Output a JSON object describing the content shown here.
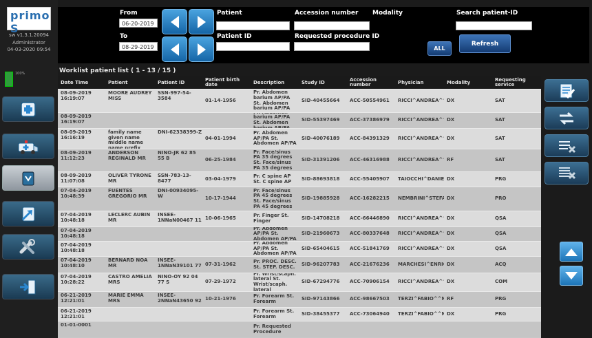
{
  "app": {
    "logo_text": "primo S",
    "version": "sw v1.3.1.20094",
    "user": "Administrator",
    "datetime": "04-03-2020 09:54",
    "battery": "100%"
  },
  "filters": {
    "from_label": "From",
    "from_value": "06-20-2019",
    "to_label": "To",
    "to_value": "08-29-2019",
    "patient_label": "Patient",
    "patient_value": "",
    "patient_id_label": "Patient ID",
    "patient_id_value": "",
    "accession_label": "Accession number",
    "accession_value": "",
    "requested_proc_label": "Requested procedure ID",
    "requested_proc_value": "",
    "modality_label": "Modality",
    "modality_button": "ALL",
    "search_patient_id_label": "Search patient-ID",
    "search_patient_id_value": "",
    "refresh_label": "Refresh"
  },
  "worklist": {
    "title": "Worklist patient list ( 1 - 13 / 15 )",
    "columns": [
      "Date Time",
      "Patient",
      "Patient ID",
      "Patient birth date",
      "Description",
      "Study ID",
      "Accession number",
      "Physician",
      "Modality",
      "Requesting service"
    ],
    "rows": [
      {
        "datetime": "08-09-2019 16:19:07",
        "patient": "MOORE AUDREY MISS",
        "patient_id": "SSN-997-54-3584",
        "birth": "01-14-1956",
        "description": "Pr. Abdomen barium AP/PA St. Abdomen barium AP/PA",
        "study_id": "SID-40455664",
        "accession": "ACC-50554961",
        "physician": "RICCI^ANDREA^^",
        "modality": "DX",
        "service": "SAT"
      },
      {
        "datetime": "08-09-2019 16:19:07",
        "patient": "",
        "patient_id": "",
        "birth": "",
        "description": "Pr. Abdomen barium AP/PA St. Abdomen barium AP/PA",
        "study_id": "SID-55397469",
        "accession": "ACC-37386979",
        "physician": "RICCI^ANDREA^^",
        "modality": "DX",
        "service": "SAT"
      },
      {
        "datetime": "08-09-2019 16:16:19",
        "patient": "family name given name middle name name prefix name suffix",
        "patient_id": "DNI-62338399-Z",
        "birth": "04-01-1994",
        "description": "Pr. Abdomen AP/PA St. Abdomen AP/PA",
        "study_id": "SID-40076189",
        "accession": "ACC-84391329",
        "physician": "RICCI^ANDREA^^",
        "modality": "DX",
        "service": "SAT"
      },
      {
        "datetime": "08-09-2019 11:12:23",
        "patient": "ANDERSON REGINALD MR",
        "patient_id": "NINO-JR 62 85 55 B",
        "birth": "06-25-1984",
        "description": "Pr. Face/sinus PA 35 degrees St. Face/sinus PA 35 degrees",
        "study_id": "SID-31391206",
        "accession": "ACC-46316988",
        "physician": "RICCI^ANDREA^^",
        "modality": "RF",
        "service": "SAT"
      },
      {
        "datetime": "08-09-2019 11:07:08",
        "patient": "OLIVER TYRONE MR",
        "patient_id": "SSN-783-13-8477",
        "birth": "03-04-1979",
        "description": "Pr. C spine AP St. C spine AP",
        "study_id": "SID-88693818",
        "accession": "ACC-55405907",
        "physician": "TAIOCCHI^DANIELE",
        "modality": "DX",
        "service": "PRG"
      },
      {
        "datetime": "07-04-2019 10:48:39",
        "patient": "FUENTES GREGORIO MR",
        "patient_id": "DNI-00934095-W",
        "birth": "10-17-1944",
        "description": "Pr. Face/sinus PA 45 degrees St. Face/sinus PA 45 degrees",
        "study_id": "SID-19885928",
        "accession": "ACC-16282215",
        "physician": "NEMBRINI^STEFANO",
        "modality": "DX",
        "service": "PRO"
      },
      {
        "datetime": "07-04-2019 10:48:18",
        "patient": "LECLERC AUBIN MR",
        "patient_id": "INSEE-1NNaN00467 11",
        "birth": "10-06-1965",
        "description": "Pr. Finger St. Finger",
        "study_id": "SID-14708218",
        "accession": "ACC-66446890",
        "physician": "RICCI^ANDREA^^",
        "modality": "DX",
        "service": "QSA"
      },
      {
        "datetime": "07-04-2019 10:48:18",
        "patient": "",
        "patient_id": "",
        "birth": "",
        "description": "Pr. Abdomen AP/PA St. Abdomen AP/PA",
        "study_id": "SID-21960673",
        "accession": "ACC-80337648",
        "physician": "RICCI^ANDREA^^",
        "modality": "DX",
        "service": "QSA"
      },
      {
        "datetime": "07-04-2019 10:48:18",
        "patient": "",
        "patient_id": "",
        "birth": "",
        "description": "Pr. Abdomen AP/PA St. Abdomen AP/PA",
        "study_id": "SID-65404615",
        "accession": "ACC-51841769",
        "physician": "RICCI^ANDREA^^",
        "modality": "DX",
        "service": "QSA"
      },
      {
        "datetime": "07-04-2019 10:48:10",
        "patient": "BERNARD NOA MR",
        "patient_id": "INSEE-1NNaN39101 77",
        "birth": "07-31-1962",
        "description": "Pr. PROC. DESC. St. STEP. DESC.",
        "study_id": "SID-96207783",
        "accession": "ACC-21676236",
        "physician": "MARCHESI^ENRICO",
        "modality": "DX",
        "service": "ACQ"
      },
      {
        "datetime": "07-04-2019 10:28:22",
        "patient": "CASTRO AMELIA MRS",
        "patient_id": "NINO-OY 92 04 77 S",
        "birth": "07-29-1972",
        "description": "Pr. Wrist/scaph. lateral St. Wrist/scaph. lateral",
        "study_id": "SID-67294776",
        "accession": "ACC-70906154",
        "physician": "RICCI^ANDREA^^",
        "modality": "DX",
        "service": "COM"
      },
      {
        "datetime": "06-21-2019 12:21:01",
        "patient": "MARIE EMMA MRS",
        "patient_id": "INSEE-2NNaN43650 92",
        "birth": "10-21-1976",
        "description": "Pr. Forearm St. Forearm",
        "study_id": "SID-97143866",
        "accession": "ACC-98667503",
        "physician": "TERZI^FABIO^^MD",
        "modality": "RF",
        "service": "PRG"
      },
      {
        "datetime": "06-21-2019 12:21:01",
        "patient": "",
        "patient_id": "",
        "birth": "",
        "description": "Pr. Forearm St. Forearm",
        "study_id": "SID-38455377",
        "accession": "ACC-73064940",
        "physician": "TERZI^FABIO^^MD",
        "modality": "DX",
        "service": "PRG"
      },
      {
        "datetime": "01-01-0001",
        "patient": "",
        "patient_id": "",
        "birth": "",
        "description": "Pr. Requested Procedure",
        "study_id": "",
        "accession": "",
        "physician": "",
        "modality": "",
        "service": ""
      }
    ]
  },
  "icons": {
    "sidebar": [
      "new-patient-icon",
      "ambulance-icon",
      "edit-icon",
      "export-icon",
      "tools-icon",
      "exit-icon"
    ],
    "right": [
      "checklist-icon",
      "transfer-icon",
      "delete-list-icon",
      "delete-all-icon",
      "scroll-up-icon",
      "scroll-down-icon"
    ]
  },
  "colors": {
    "accent": "#2a87d0",
    "header_bg": "#000000",
    "row_light": "#dcdcdc",
    "row_dark": "#c5c5c5"
  }
}
